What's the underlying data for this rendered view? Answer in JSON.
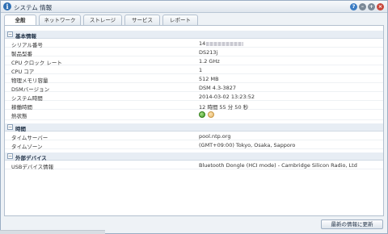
{
  "window": {
    "title": "システム 情報",
    "buttons": {
      "help": "?",
      "minimize": "–",
      "maximize": "+",
      "close": "×"
    }
  },
  "tabs": [
    {
      "label": "全般",
      "active": true
    },
    {
      "label": "ネットワーク",
      "active": false
    },
    {
      "label": "ストレージ",
      "active": false
    },
    {
      "label": "サービス",
      "active": false
    },
    {
      "label": "レポート",
      "active": false
    }
  ],
  "sections": {
    "basic": {
      "title": "基本情報",
      "rows": [
        {
          "label": "シリアル番号",
          "value": "14"
        },
        {
          "label": "製品型番",
          "value": "DS213j"
        },
        {
          "label": "CPU クロック レート",
          "value": "1.2 GHz"
        },
        {
          "label": "CPU コア",
          "value": "1"
        },
        {
          "label": "物理メモリ容量",
          "value": "512 MB"
        },
        {
          "label": "DSMバージョン",
          "value": "DSM 4.3-3827"
        },
        {
          "label": "システム時間",
          "value": "2014-03-02 13:23:52"
        },
        {
          "label": "稼働時間",
          "value": "12 時間 55 分 50 秒"
        },
        {
          "label": "熱状態",
          "value": ""
        }
      ]
    },
    "time": {
      "title": "時間",
      "rows": [
        {
          "label": "タイムサーバー",
          "value": "pool.ntp.org"
        },
        {
          "label": "タイムゾーン",
          "value": "(GMT+09:00) Tokyo, Osaka, Sapporo"
        }
      ]
    },
    "external": {
      "title": "外部デバイス",
      "rows": [
        {
          "label": "USBデバイス情報",
          "value": "Bluetooth Dongle (HCI mode) - Cambridge Silicon Radio, Ltd"
        }
      ]
    }
  },
  "thermal_status": {
    "normal_color": "#3e9a22",
    "warning_color": "#e7b768"
  },
  "actions": {
    "refresh_label": "最新の情報に更新"
  },
  "icons": {
    "app": "info-icon",
    "collapse": "collapse-toggle-icon",
    "thermal_normal": "status-normal-icon",
    "thermal_warning": "status-warning-icon"
  }
}
